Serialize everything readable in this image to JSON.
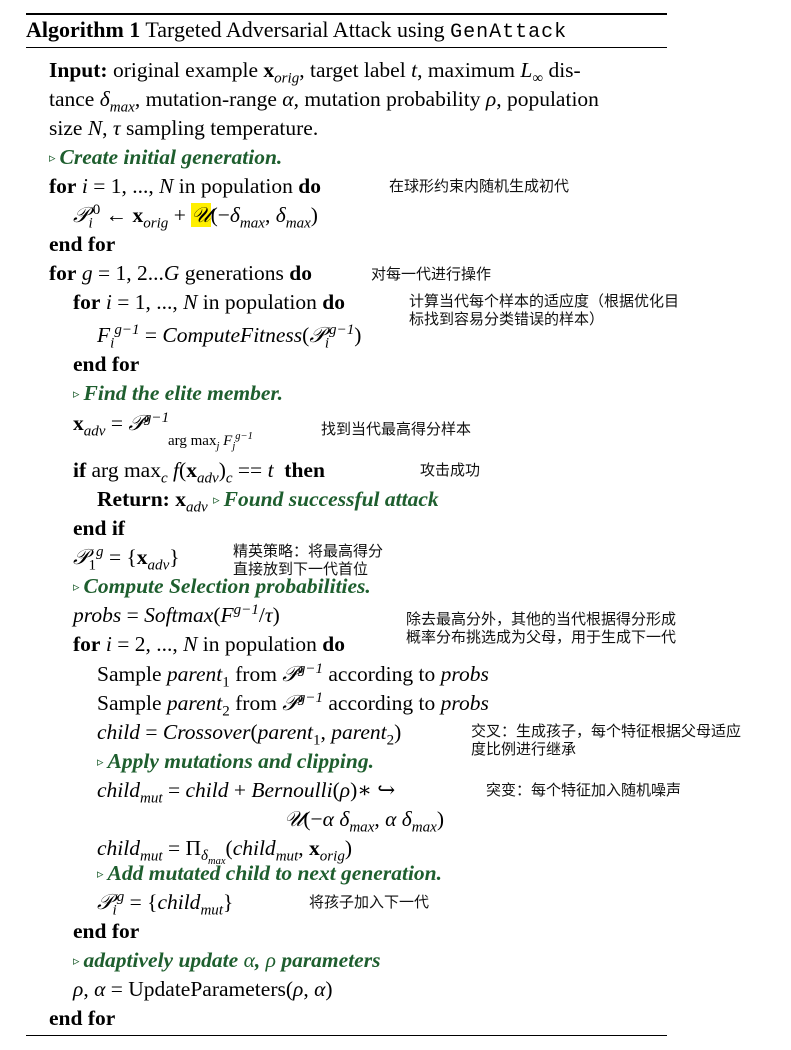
{
  "header": {
    "label": "Algorithm 1",
    "title": "Targeted Adversarial Attack using",
    "name": "GenAttack"
  },
  "lines": {
    "l1": "Input: original example x_orig, target label t, maximum L∞ dis-",
    "l2": "tance δmax, mutation-range α, mutation probability ρ, population",
    "l3": "size N, τ sampling temperature.",
    "l4": "Create initial generation.",
    "l5": "for i = 1, ..., N in population do",
    "l6": "P_i^0 ← x_orig + U(−δmax, δmax)",
    "l7": "end for",
    "l8": "for g = 1, 2...G generations do",
    "l9": "for i = 1, ..., N in population do",
    "l10": "F_i^(g−1) = ComputeFitness(P_i^(g−1))",
    "l11": "end for",
    "l12": "Find the elite member.",
    "l13": "x_adv = P^(g−1)_(arg max_j F_j^(g−1))",
    "l14": "if arg max_c f(x_adv)_c == t then",
    "l15": "Return: x_adv ▹ Found successful attack",
    "l16": "end if",
    "l17": "P_1^g = {x_adv}",
    "l18": "Compute Selection probabilities.",
    "l19": "probs = Softmax(F^(g−1)/τ)",
    "l20": "for i = 2, ..., N in population do",
    "l21": "Sample parent1 from P^(g−1) according to probs",
    "l22": "Sample parent2 from P^(g−1) according to probs",
    "l23": "child = Crossover(parent1, parent2)",
    "l24": "Apply mutations and clipping.",
    "l25": "child_mut = child + Bernoulli(ρ)* ↪",
    "l26": "U(−α δmax, α δmax)",
    "l27": "child_mut = Π_δmax(child_mut, x_orig)",
    "l28": "Add mutated child to next generation.",
    "l29": "P_i^g = {child_mut}",
    "l30": "end for",
    "l31": "adaptively update α, ρ parameters",
    "l32": "ρ, α = UpdateParameters(ρ, α)",
    "l33": "end for"
  },
  "notes": {
    "n1": "在球形约束内随机生成初代",
    "n2": "对每一代进行操作",
    "n3a": "计算当代每个样本的适应度（根据优化目",
    "n3b": "标找到容易分类错误的样本）",
    "n4": "找到当代最高得分样本",
    "n5": "攻击成功",
    "n6a": "精英策略：将最高得分",
    "n6b": "直接放到下一代首位",
    "n7a": "除去最高分外，其他的当代根据得分形成",
    "n7b": "概率分布挑选成为父母，用于生成下一代",
    "n8a": "交叉：生成孩子，每个特征根据父母适应",
    "n8b": "度比例进行继承",
    "n9": "突变：每个特征加入随机噪声",
    "n10": "将孩子加入下一代"
  },
  "colors": {
    "comment": "#1e5e2e",
    "highlight": "#ffef00"
  }
}
